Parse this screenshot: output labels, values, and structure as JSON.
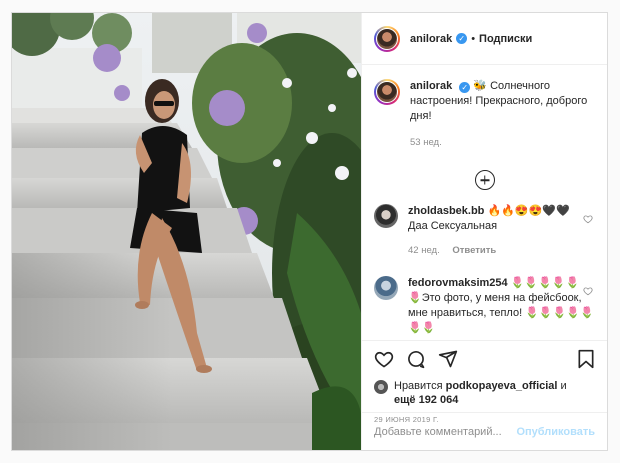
{
  "post": {
    "username": "anilorak",
    "follow_label": "Подписки",
    "separator": "•"
  },
  "caption": {
    "username": "anilorak",
    "emoji": "🐝",
    "text": "Солнечного настроения! Прекрасного, доброго дня!",
    "age": "53 нед."
  },
  "comments": [
    {
      "username": "zholdasbek.bb",
      "emoji": "🔥🔥😍😍🖤🖤",
      "text": "Даа Сексуальная",
      "age": "42 нед.",
      "reply_label": "Ответить"
    },
    {
      "username": "fedorovmaksim254",
      "emoji": "🌷🌷🌷🌷🌷",
      "text": "🌷Это фото, у меня на фейсбоок, мне нравиться, тепло! 🌷🌷🌷🌷🌷🌷🌷"
    }
  ],
  "likes": {
    "prefix": "Нравится",
    "user": "podkopayeva_official",
    "and": "и",
    "more": "ещё 192 064"
  },
  "date": "29 ИЮНЯ 2019 Г.",
  "add_comment": {
    "placeholder": "Добавьте комментарий...",
    "publish_label": "Опубликовать"
  },
  "icons": [
    "heart-icon",
    "comment-icon",
    "share-icon",
    "bookmark-icon",
    "add-circle-icon",
    "verified-icon"
  ],
  "colors": {
    "accent_blue": "#3897f0",
    "publish_disabled": "#b2dffc",
    "muted": "#8e8e8e",
    "text": "#262626"
  }
}
